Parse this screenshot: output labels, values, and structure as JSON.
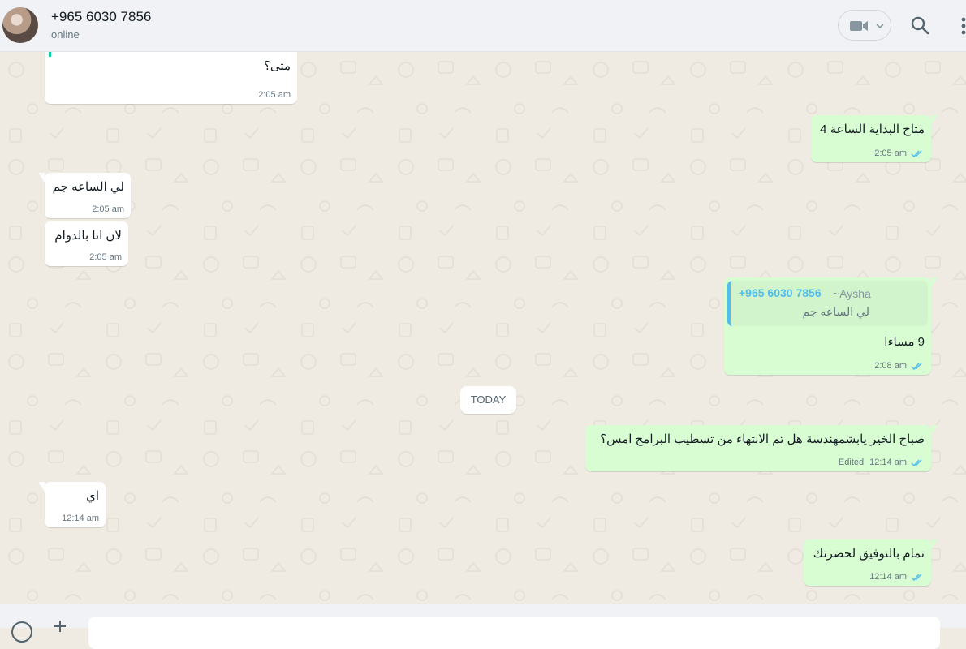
{
  "header": {
    "contact_name": "+965 6030 7856",
    "status": "online",
    "icons": [
      "avatar",
      "video-call-icon",
      "chevron-down-icon",
      "search-icon",
      "menu-icon"
    ]
  },
  "date_separator": "TODAY",
  "messages": [
    {
      "dir": "in",
      "text": "متى؟",
      "time": "2:05 am"
    },
    {
      "dir": "out",
      "text": "متاح البداية الساعة 4",
      "time": "2:05 am",
      "read": true
    },
    {
      "dir": "in",
      "text": "لي الساعه جم",
      "time": "2:05 am"
    },
    {
      "dir": "in",
      "text": "لان انا بالدوام",
      "time": "2:05 am"
    },
    {
      "dir": "out",
      "text": "9 مساءا",
      "time": "2:08 am",
      "read": true,
      "quote": {
        "number": "+965 6030 7856",
        "alias": "~Aysha",
        "text": "لي الساعه جم"
      }
    },
    {
      "dir": "out",
      "text": "صباح الخير يابشمهندسة هل تم الانتهاء من تسطيب البرامج امس؟",
      "time": "12:14 am",
      "edited": "Edited",
      "read": true
    },
    {
      "dir": "in",
      "text": "اي",
      "time": "12:14 am"
    },
    {
      "dir": "out",
      "text": "تمام بالتوفيق لحضرتك",
      "time": "12:14 am",
      "read": true
    }
  ],
  "colors": {
    "chat_bg": "#efeae2",
    "bubble_out": "#d9fdd3",
    "bubble_in": "#ffffff",
    "read_ticks": "#53bdeb"
  }
}
